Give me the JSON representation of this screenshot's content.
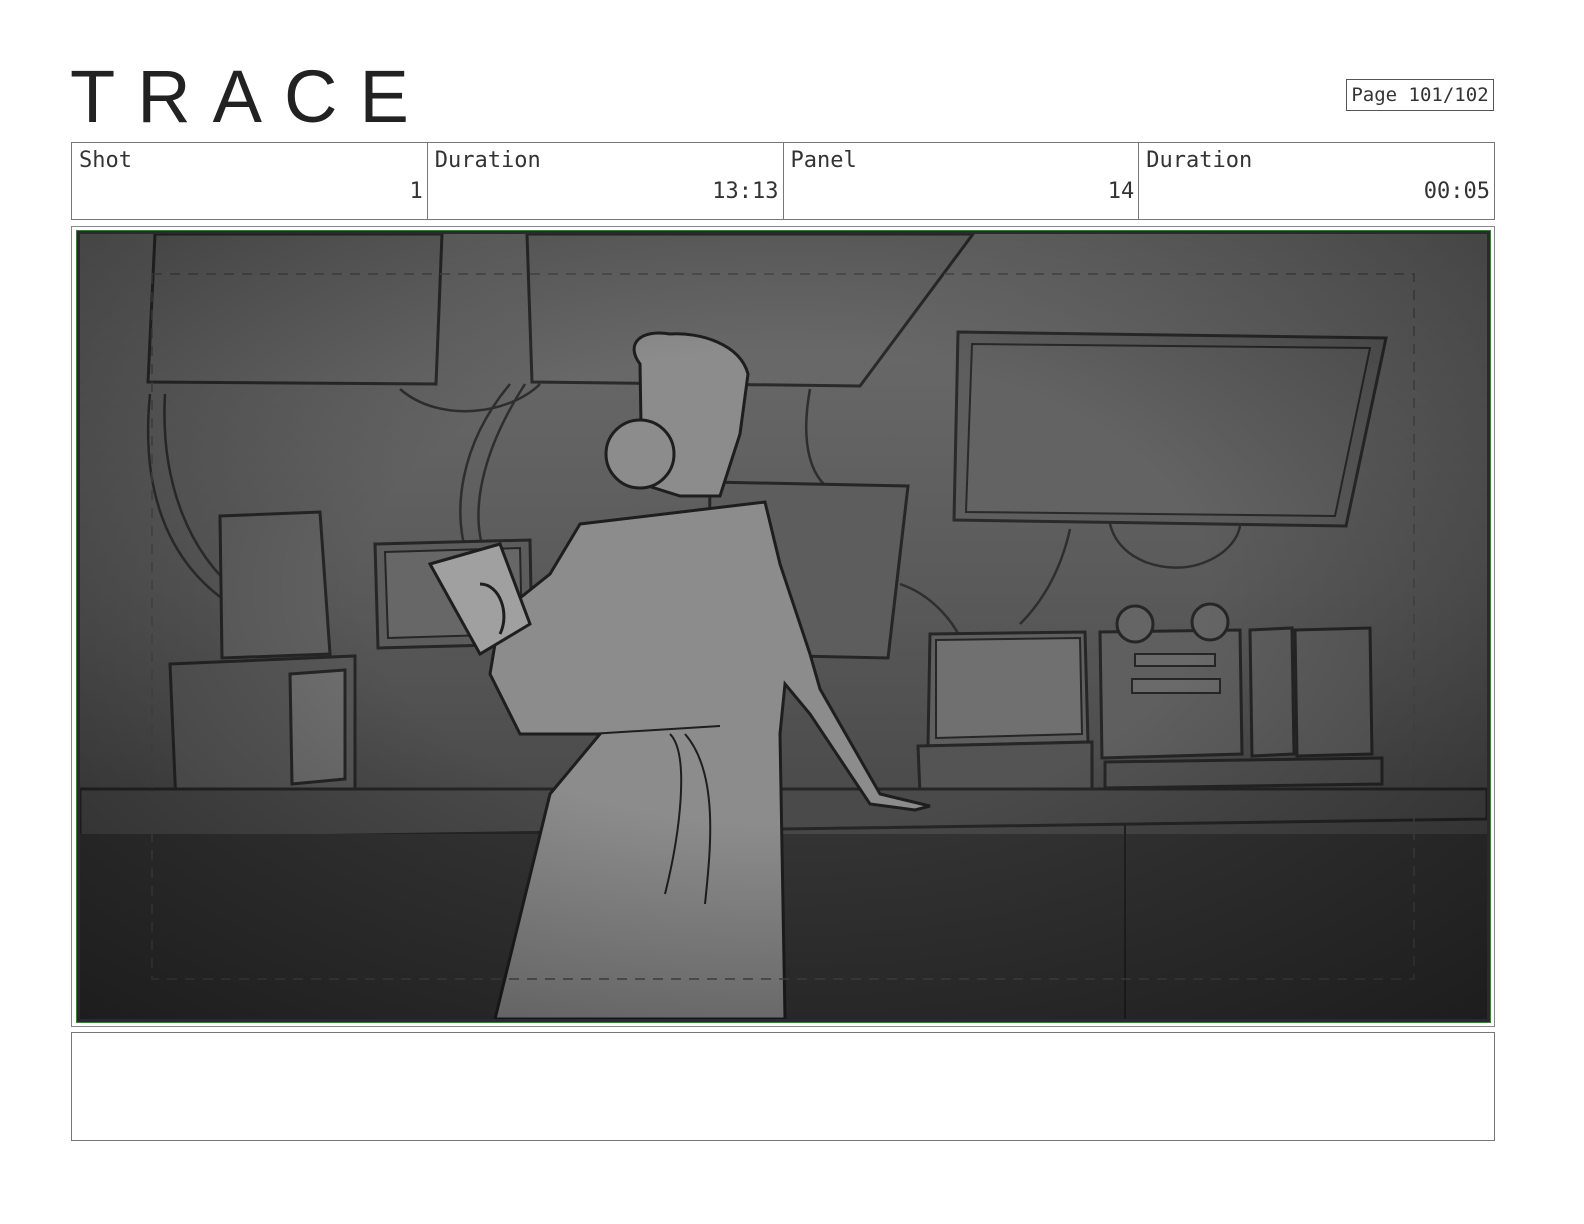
{
  "header": {
    "logo_text": "TRACE",
    "page_indicator": "Page 101/102"
  },
  "info_row": {
    "shot_label": "Shot",
    "shot_value": "1",
    "shot_duration_label": "Duration",
    "shot_duration_value": "13:13",
    "panel_label": "Panel",
    "panel_value": "14",
    "panel_duration_label": "Duration",
    "panel_duration_value": "00:05"
  },
  "panel": {
    "image_subject": "storyboard-sketch-woman-at-control-console"
  },
  "notes": {
    "text": ""
  }
}
